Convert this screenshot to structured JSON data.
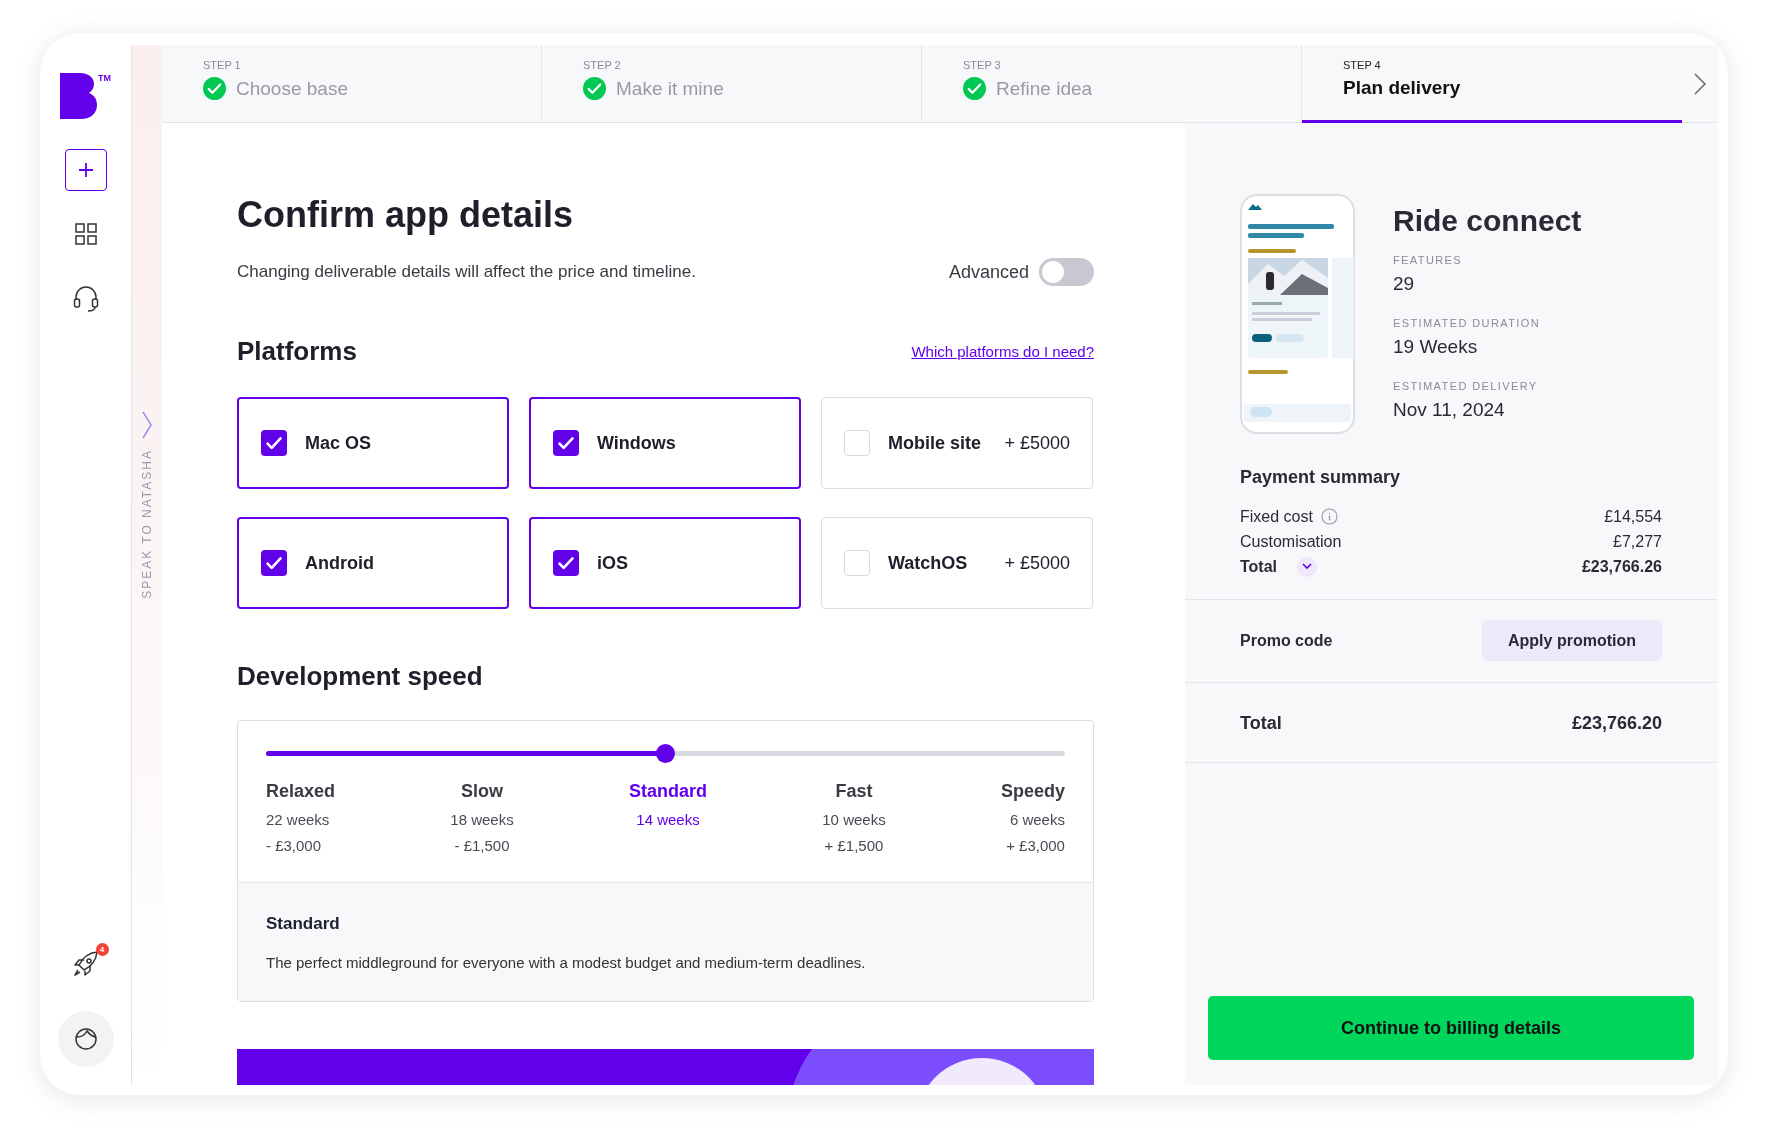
{
  "sidebar": {
    "logo_mark": "TM",
    "notification_count": "4",
    "side_tab": "SPEAK TO NATASHA"
  },
  "steps": [
    {
      "step": "STEP 1",
      "label": "Choose base",
      "done": true,
      "selected": false
    },
    {
      "step": "STEP 2",
      "label": "Make it mine",
      "done": true,
      "selected": false
    },
    {
      "step": "STEP 3",
      "label": "Refine idea",
      "done": true,
      "selected": false
    },
    {
      "step": "STEP 4",
      "label": "Plan delivery",
      "done": false,
      "selected": true
    }
  ],
  "details": {
    "title": "Confirm app details",
    "subtitle": "Changing deliverable details will affect the price and timeline.",
    "advanced": {
      "label": "Advanced",
      "on": false
    }
  },
  "platforms": {
    "title": "Platforms",
    "help_link": "Which platforms do I need?",
    "options": [
      {
        "label": "Mac OS",
        "checked": true
      },
      {
        "label": "Windows",
        "checked": true
      },
      {
        "label": "Mobile site",
        "price": "+ £5000",
        "checked": false
      },
      {
        "label": "Android",
        "checked": true
      },
      {
        "label": "iOS",
        "checked": true
      },
      {
        "label": "WatchOS",
        "price": "+ £5000",
        "checked": false
      }
    ]
  },
  "development_speed": {
    "title": "Development speed",
    "level": 0.5,
    "options": [
      {
        "label": "Relaxed",
        "weeks": "22 weeks",
        "price": "- £3,000",
        "selected": false
      },
      {
        "label": "Slow",
        "weeks": "18 weeks",
        "price": "- £1,500",
        "selected": false
      },
      {
        "label": "Standard",
        "weeks": "14 weeks",
        "selected": true
      },
      {
        "label": "Fast",
        "weeks": "10 weeks",
        "price": "+ £1,500",
        "selected": false
      },
      {
        "label": "Speedy",
        "weeks": "6 weeks",
        "price": "+ £3,000",
        "selected": false
      }
    ],
    "detail_title": "Standard",
    "detail_text": "The perfect middleground for everyone with a modest budget and medium-term deadlines."
  },
  "project": {
    "name": "Ride connect",
    "stats": [
      {
        "label": "FEATURES",
        "value": "29"
      },
      {
        "label": "ESTIMATED DURATION",
        "value": "19 Weeks"
      },
      {
        "label": "ESTIMATED DELIVERY",
        "value": "Nov 11, 2024"
      }
    ]
  },
  "payment_summary": {
    "title": "Payment summary",
    "rows": [
      {
        "kind": "info",
        "label": "Fixed cost",
        "value": "£14,554"
      },
      {
        "kind": "plain",
        "label": "Customisation",
        "value": "£7,277"
      },
      {
        "kind": "total",
        "label": "Total",
        "value": "£23,766.26"
      }
    ]
  },
  "promo": {
    "label": "Promo code",
    "button": "Apply promotion"
  },
  "total": {
    "label": "Total",
    "value": "£23,766.20"
  },
  "continue_button": "Continue to billing details"
}
